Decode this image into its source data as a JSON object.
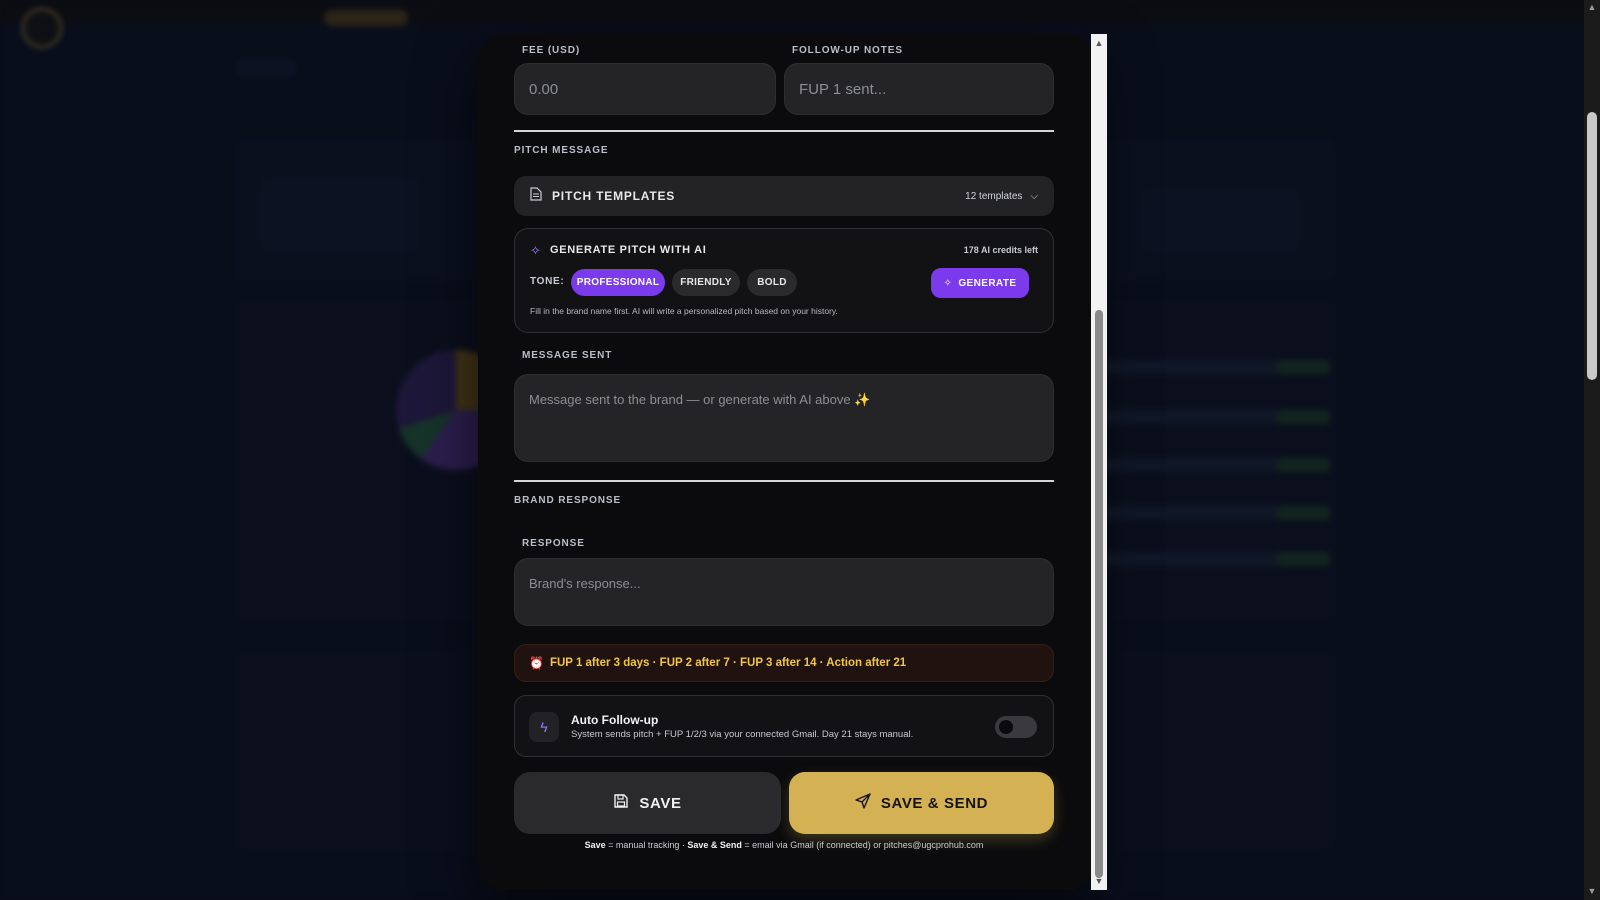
{
  "fee": {
    "label": "FEE (USD)",
    "placeholder": "0.00"
  },
  "followup_notes": {
    "label": "FOLLOW-UP NOTES",
    "placeholder": "FUP 1 sent..."
  },
  "pitch_section": {
    "heading": "PITCH MESSAGE"
  },
  "templates": {
    "title": "PITCH TEMPLATES",
    "count": "12 templates"
  },
  "ai": {
    "title": "GENERATE PITCH WITH AI",
    "credits": "178 AI credits left",
    "tone_label": "TONE:",
    "tones": [
      "PROFESSIONAL",
      "FRIENDLY",
      "BOLD"
    ],
    "selected_tone": "PROFESSIONAL",
    "generate_label": "GENERATE",
    "hint": "Fill in the brand name first. AI will write a personalized pitch based on your history."
  },
  "message": {
    "label": "MESSAGE SENT",
    "placeholder": "Message sent to the brand — or generate with AI above ✨"
  },
  "brand_section": {
    "heading": "BRAND RESPONSE"
  },
  "response": {
    "label": "RESPONSE",
    "placeholder": "Brand's response..."
  },
  "schedule": {
    "text": "FUP 1 after 3 days · FUP 2 after 7 · FUP 3 after 14 · Action after 21"
  },
  "auto_followup": {
    "title": "Auto Follow-up",
    "description": "System sends pitch + FUP 1/2/3 via your connected Gmail. Day 21 stays manual.",
    "enabled": false
  },
  "actions": {
    "save_label": "SAVE",
    "save_send_label": "SAVE & SEND"
  },
  "footnote": {
    "save": "Save",
    "save_desc": " = manual tracking · ",
    "save_send": "Save & Send",
    "save_send_desc": " = email via Gmail (if connected) or pitches@ugcprohub.com"
  },
  "colors": {
    "accent_purple": "#7c3aed",
    "gold": "#d4b254",
    "warning_text": "#f2c744"
  },
  "icons": {
    "templates": "document-icon",
    "ai": "sparkles-icon",
    "generate": "sparkles-icon",
    "schedule": "alarm-clock-icon",
    "auto": "lightning-icon",
    "save": "floppy-disk-icon",
    "send": "paper-plane-icon"
  }
}
